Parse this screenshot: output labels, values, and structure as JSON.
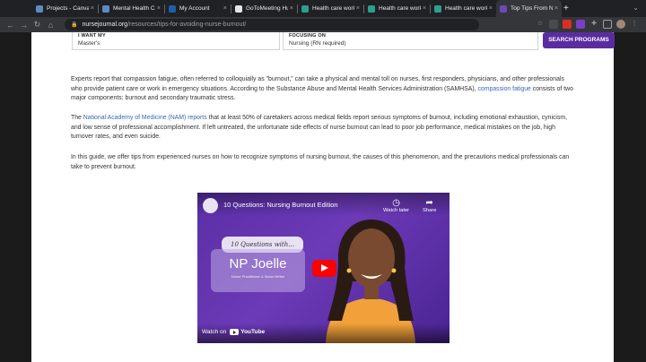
{
  "browser": {
    "tabs": [
      {
        "label": "Projects - Canva",
        "color": "#5f89c5",
        "active": false
      },
      {
        "label": "Mental Health Ca",
        "color": "#5f89c5",
        "active": false
      },
      {
        "label": "My Account",
        "color": "#1f5fa8",
        "active": false
      },
      {
        "label": "GoToMeeting Hub",
        "color": "#e6e6e6",
        "active": false
      },
      {
        "label": "Health care work",
        "color": "#2d9f8f",
        "active": false
      },
      {
        "label": "Health care work",
        "color": "#2d9f8f",
        "active": false
      },
      {
        "label": "Health care work",
        "color": "#2d9f8f",
        "active": false
      },
      {
        "label": "Top Tips From N",
        "color": "#6a4bb8",
        "active": true
      }
    ],
    "new_tab": "+",
    "url_host": "nursejournal.org",
    "url_path": "/resources/tips-for-avoiding-nurse-burnout/"
  },
  "filters": {
    "want_label": "I WANT MY",
    "want_value": "Master's",
    "focus_label": "FOCUSING ON",
    "focus_value": "Nursing (RN required)",
    "search_button": "SEARCH PROGRAMS"
  },
  "article": {
    "p1_text": "Experts report that compassion fatigue, often referred to colloquially as \"burnout,\" can take a physical and mental toll on nurses, first responders, physicians, and other professionals who provide patient care or work in emergency situations. According to the Substance Abuse and Mental Health Services Administration (SAMHSA), ",
    "p1_link": "compassion fatigue",
    "p1_tail": " consists of two major components: burnout and secondary traumatic stress.",
    "p2_pre": "The ",
    "p2_link": "National Academy of Medicine (NAM) reports",
    "p2_tail": " that at least 50% of caretakers across medical fields report serious symptoms of burnout, including emotional exhaustion, cynicism, and low sense of professional accomplishment. If left untreated, the unfortunate side effects of nurse burnout can lead to poor job performance, medical mistakes on the job, high turnover rates, and even suicide.",
    "p3": "In this guide, we offer tips from experienced nurses on how to recognize symptoms of nursing burnout, the causes of this phenomenon, and the precautions medical professionals can take to prevent burnout."
  },
  "video": {
    "title": "10 Questions: Nursing Burnout Edition",
    "watch_later": "Watch later",
    "share": "Share",
    "card_tagline": "10 Questions with...",
    "card_name": "NP Joelle",
    "card_sub": "Nurse Practitioner & Nurse Writer",
    "watch_on": "Watch on",
    "youtube": "YouTube"
  }
}
